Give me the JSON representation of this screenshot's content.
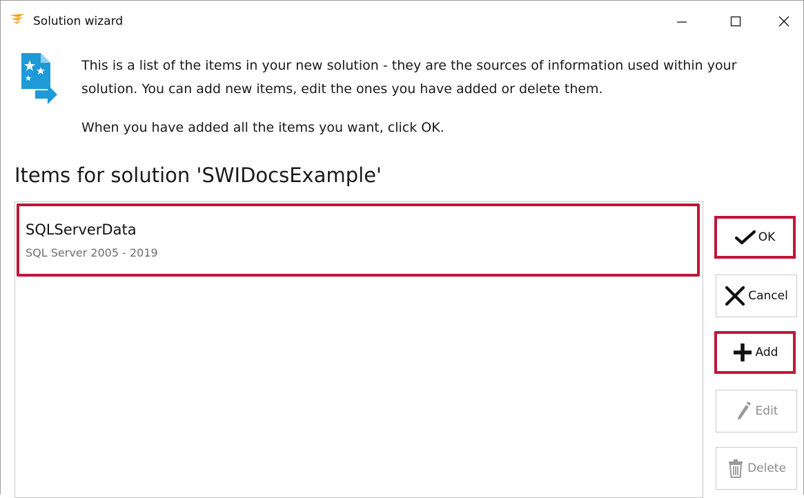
{
  "window": {
    "title": "Solution wizard",
    "controls": {
      "minimize": "—",
      "maximize": "☐",
      "close": "✕"
    }
  },
  "intro": {
    "line1": "This is a list of the items in your new solution - they are the sources of information used within your",
    "line2": "solution. You can add new items, edit the ones you have added or delete them.",
    "line3": "When you have added all the items you want, click OK."
  },
  "section_title": "Items for solution 'SWIDocsExample'",
  "items": [
    {
      "name": "SQLServerData",
      "type": "SQL Server 2005 - 2019"
    }
  ],
  "buttons": {
    "ok": "OK",
    "cancel": "Cancel",
    "add": "Add",
    "edit": "Edit",
    "delete": "Delete"
  },
  "colors": {
    "highlight": "#c0163a",
    "icon_blue": "#1e9ad6",
    "app_orange": "#f39c12",
    "disabled_text": "#8c8c8c"
  },
  "icons": {
    "app": "solarwinds-flame-icon",
    "info": "document-stars-arrow-icon",
    "ok": "checkmark-icon",
    "cancel": "x-icon",
    "add": "plus-icon",
    "edit": "pencil-icon",
    "delete": "trash-icon"
  }
}
